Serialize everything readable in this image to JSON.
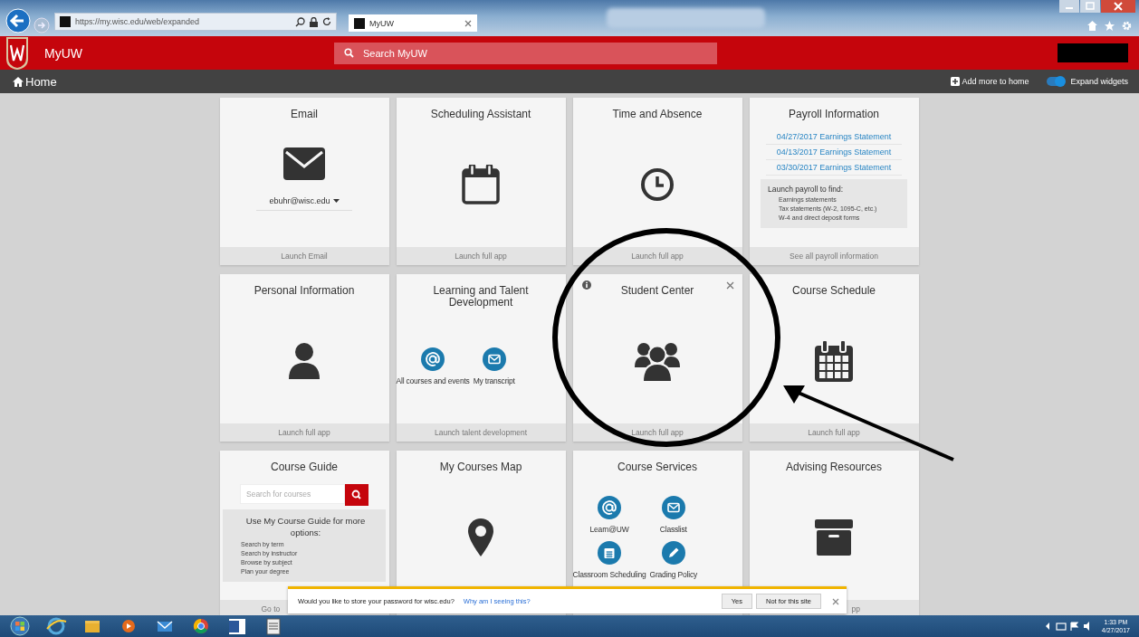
{
  "browser": {
    "address": "https://my.wisc.edu/web/expanded",
    "tab_title": "MyUW"
  },
  "header": {
    "title": "MyUW",
    "search_placeholder": "Search MyUW"
  },
  "nav": {
    "home": "Home",
    "add_more": "Add more to home",
    "expand_widgets": {
      "label": "Expand widgets",
      "on": true
    }
  },
  "widgets": [
    {
      "kind": "email",
      "title": "Email",
      "account": "ebuhr@wisc.edu",
      "footer": "Launch Email",
      "controls_shown": false
    },
    {
      "kind": "icon",
      "title": "Scheduling Assistant",
      "footer": "Launch full app",
      "controls_shown": false
    },
    {
      "kind": "icon",
      "title": "Time and Absence",
      "footer": "Launch full app",
      "controls_shown": false
    },
    {
      "kind": "links",
      "title": "Payroll Information",
      "links": [
        "04/27/2017 Earnings Statement",
        "04/13/2017 Earnings Statement",
        "03/30/2017 Earnings Statement"
      ],
      "info_title": "Launch payroll to find:",
      "bullets": [
        "Earnings statements",
        "Tax statements (W-2, 1095-C, etc.)",
        "W-4 and direct deposit forms"
      ],
      "footer": "See all payroll information",
      "controls_shown": false
    },
    {
      "kind": "icon",
      "title": "Personal Information",
      "footer": "Launch full app",
      "controls_shown": false
    },
    {
      "kind": "apps",
      "title": "Learning and Talent Development",
      "apps": [
        "All courses and events",
        "My transcript"
      ],
      "footer": "Launch talent development",
      "controls_shown": false
    },
    {
      "kind": "icon",
      "title": "Student Center",
      "footer": "Launch full app",
      "controls_shown": true
    },
    {
      "kind": "icon",
      "title": "Course Schedule",
      "footer": "Launch full app",
      "controls_shown": false
    },
    {
      "kind": "search",
      "title": "Course Guide",
      "placeholder": "Search for courses",
      "info_title": "Use My Course Guide for more options:",
      "bullets": [
        "Search by term",
        "Search by instructor",
        "Browse by subject",
        "Plan your degree"
      ],
      "footer": "Go to",
      "controls_shown": false
    },
    {
      "kind": "icon",
      "title": "My Courses Map",
      "controls_shown": false
    },
    {
      "kind": "apps",
      "title": "Course Services",
      "apps": [
        "Learn@UW",
        "Classlist",
        "Classroom Scheduling",
        "Grading Policy"
      ],
      "controls_shown": false
    },
    {
      "kind": "icon",
      "title": "Advising Resources",
      "footer": "pp",
      "controls_shown": false
    }
  ],
  "password_prompt": {
    "message": "Would you like to store your password for wisc.edu?",
    "link": "Why am I seeing this?",
    "buttons": [
      "Yes",
      "Not for this site"
    ]
  },
  "taskbar": {
    "time": "1:33 PM",
    "date": "4/27/2017"
  }
}
